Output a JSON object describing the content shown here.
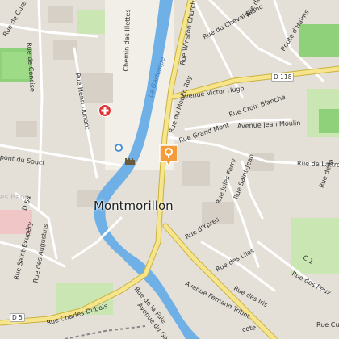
{
  "map": {
    "town": "Montmorillon",
    "river": "La Gartempe",
    "colors": {
      "land": "#f2efe9",
      "water": "#6fb0e6",
      "park": "#c9e6b3",
      "sport": "#8fd17a",
      "residential": "#e4e0d8",
      "road_major": "#f6e58d",
      "road_minor": "#ffffff",
      "marker": "#f49b3a",
      "hospital": "#d33333"
    },
    "labels": {
      "rue_de_concise": "Rue de Concise",
      "rue_henri_dunant": "Rue Henri Dunant",
      "chemin_des_illettes": "Chemin des Illettes",
      "la_gartempe": "La Gartempe",
      "rue_winston_church": "Rue Winston Church",
      "rue_des_vieux": "Rue des",
      "rue_du_cheval_blanc": "Rue du Cheval Blanc",
      "route_dhains": "Route d'Haims",
      "d118": "D 118",
      "avenue_victor_hugo": "Avenue Victor Hugo",
      "rue_du_moulin_roy": "Rue du Moulin Roy",
      "rue_croix_blanche": "Rue Croix Blanche",
      "rue_grand_mont": "Rue Grand Mont",
      "avenue_jean_moulin": "Avenue Jean Moulin",
      "pont_du_souci": "pont du Souci",
      "rue_de_lattre": "Rue de Lattre",
      "rue_saint_jean": "Rue Saint-Jean",
      "rue_jules_ferry": "Rue Jules Ferry",
      "rue_de_cure": "Rue de Cure",
      "les_bans": "es Bans",
      "d54": "D 54",
      "montmorillon": "Montmorillon",
      "rue_dypres": "Rue d'Ypres",
      "rue_saint_exupery": "Rue Saint-Exupéry",
      "rue_des_augustins": "Rue des Augustins",
      "rue_des_lilas": "Rue des Lilas",
      "rue_des_peux": "Rue des Peux",
      "rue_des_iris": "Rue des Iris",
      "avenue_fernand_tribot": "Avenue Fernand Tribot",
      "rue_charles_dubois": "Rue Charles Dubois",
      "rue_de_la_fuie": "Rue de la Fuie",
      "avenue_du_general": "Avenue du Général",
      "d5": "D 5",
      "c1": "C 1",
      "rue_cu": "Rue Cu",
      "rue_de_la_rochelle": "Rue de la",
      "cote": "cote"
    },
    "icons": {
      "marker": "location-marker-icon",
      "hospital": "hospital-icon",
      "castle": "castle-icon"
    }
  }
}
